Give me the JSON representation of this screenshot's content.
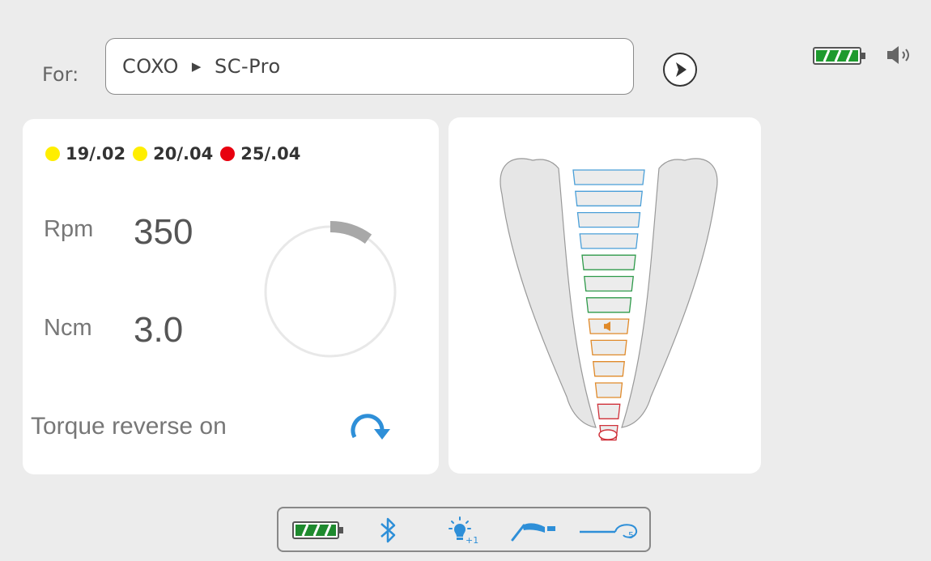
{
  "header": {
    "for_label": "For:",
    "brand": "COXO",
    "separator_symbol": "▶",
    "model": "SC-Pro",
    "icons": [
      "next-arrow-icon",
      "battery-icon",
      "speaker-icon"
    ]
  },
  "files": [
    {
      "label": "19/.02",
      "color": "#ffee00"
    },
    {
      "label": "20/.04",
      "color": "#ffee00"
    },
    {
      "label": "25/.04",
      "color": "#e8000f"
    }
  ],
  "readouts": {
    "rpm_label": "Rpm",
    "rpm_value": "350",
    "ncm_label": "Ncm",
    "ncm_value": "3.0",
    "gauge_level": 0.1
  },
  "torque": {
    "label": "Torque reverse on",
    "icon": "reverse-rotation-icon",
    "color": "#2e8fd8"
  },
  "apex_scale": {
    "segment_colors": [
      "#4a9fd8",
      "#4a9fd8",
      "#4a9fd8",
      "#4a9fd8",
      "#2e9a4a",
      "#2e9a4a",
      "#2e9a4a",
      "#e08a2a",
      "#e08a2a",
      "#e08a2a",
      "#e08a2a",
      "#d0313a",
      "#d0313a"
    ],
    "marker_index": 7,
    "marker_icon": "speaker-icon"
  },
  "status_bar": {
    "icons": [
      "battery-icon",
      "bluetooth-icon",
      "light-bulb-icon",
      "handpiece-icon",
      "apex-file-clip-icon"
    ],
    "accent": "#2e8fd8",
    "battery_color": "#1e8a2e"
  }
}
